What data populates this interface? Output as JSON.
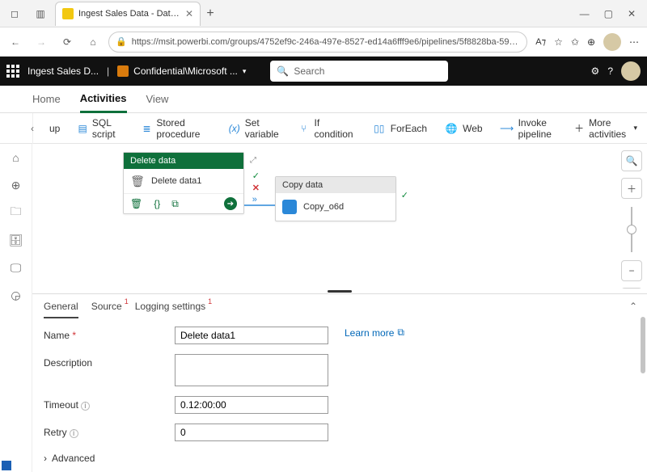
{
  "browser": {
    "tab_title": "Ingest Sales Data - Data enginee",
    "url": "https://msit.powerbi.com/groups/4752ef9c-246a-497e-8527-ed14a6fff9e6/pipelines/5f8828ba-591e-4..."
  },
  "appbar": {
    "breadcrumb": "Ingest Sales D...",
    "sensitivity_label": "Confidential\\Microsoft ...",
    "search_placeholder": "Search"
  },
  "pagetabs": {
    "home": "Home",
    "activities": "Activities",
    "view": "View"
  },
  "toolbar": {
    "up": "up",
    "sql_script": "SQL script",
    "stored_procedure": "Stored procedure",
    "set_variable": "Set variable",
    "if_condition": "If condition",
    "foreach": "ForEach",
    "web": "Web",
    "invoke_pipeline": "Invoke pipeline",
    "more": "More activities"
  },
  "canvas": {
    "delete_node": {
      "title": "Delete data",
      "label": "Delete data1"
    },
    "copy_node": {
      "title": "Copy data",
      "label": "Copy_o6d"
    }
  },
  "bottom": {
    "tabs": {
      "general": "General",
      "source": "Source",
      "logging": "Logging settings"
    },
    "labels": {
      "name": "Name",
      "description": "Description",
      "timeout": "Timeout",
      "retry": "Retry",
      "advanced": "Advanced",
      "learn_more": "Learn more"
    },
    "values": {
      "name": "Delete data1",
      "description": "",
      "timeout": "0.12:00:00",
      "retry": "0"
    }
  }
}
